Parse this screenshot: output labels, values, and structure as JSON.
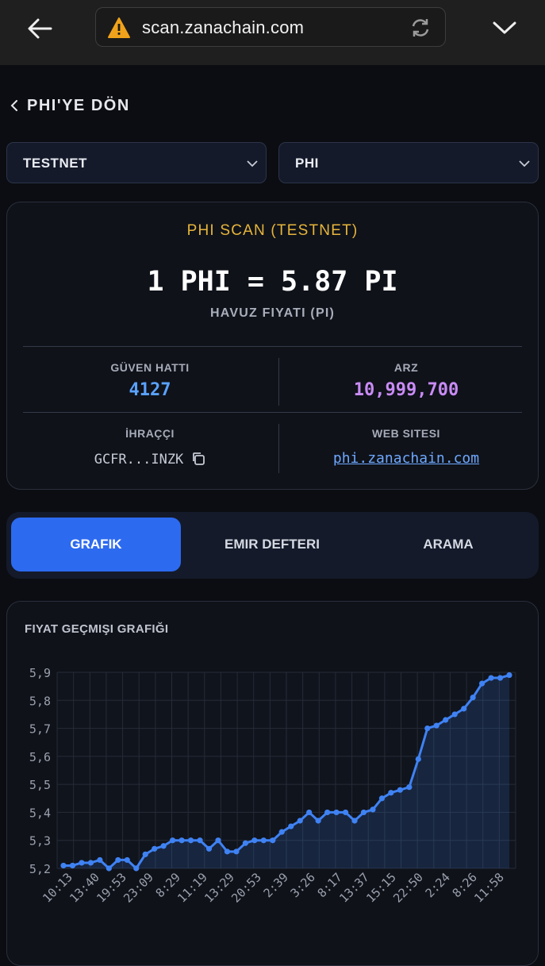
{
  "browser": {
    "url": "scan.zanachain.com",
    "icons": {
      "back": "arrow-left-icon",
      "warning": "warning-triangle-icon",
      "reload": "reload-icon",
      "menu": "chevron-down-icon"
    }
  },
  "nav": {
    "back_label": "PHI'YE DÖN"
  },
  "selectors": {
    "network": "TESTNET",
    "token": "PHI"
  },
  "card": {
    "title": "PHI SCAN (TESTNET)",
    "price": "1 PHI = 5.87 PI",
    "price_label": "HAVUZ FIYATI (PI)",
    "trustline_label": "GÜVEN HATTI",
    "trustline_value": "4127",
    "supply_label": "ARZ",
    "supply_value": "10,999,700",
    "issuer_label": "İHRAÇÇI",
    "issuer_value": "GCFR...INZK",
    "website_label": "WEB SITESI",
    "website_value": "phi.zanachain.com"
  },
  "colors": {
    "accent": "#2c6af0",
    "title_gold": "#e7b53b",
    "trustline": "#5aa2ff",
    "supply": "#c98bf5",
    "line": "#3f82f3"
  },
  "tabs": [
    {
      "label": "GRAFIK",
      "active": true
    },
    {
      "label": "EMIR DEFTERI",
      "active": false
    },
    {
      "label": "ARAMA",
      "active": false
    }
  ],
  "chart_title": "FIYAT GEÇMIŞI GRAFIĞI",
  "chart_data": {
    "type": "area",
    "title": "FIYAT GEÇMIŞI GRAFIĞI",
    "xlabel": "",
    "ylabel": "",
    "ylim": [
      5.2,
      5.9
    ],
    "yticks": [
      "5,2",
      "5,3",
      "5,4",
      "5,5",
      "5,6",
      "5,7",
      "5,8",
      "5,9"
    ],
    "xtick_labels": [
      "10:13",
      "13:40",
      "19:53",
      "23:09",
      "8:29",
      "11:19",
      "13:29",
      "20:53",
      "2:39",
      "3:26",
      "8:17",
      "13:37",
      "15:15",
      "22:50",
      "2:24",
      "8:26",
      "11:58"
    ],
    "grid": true,
    "values": [
      5.21,
      5.21,
      5.22,
      5.22,
      5.23,
      5.2,
      5.23,
      5.23,
      5.2,
      5.25,
      5.27,
      5.28,
      5.3,
      5.3,
      5.3,
      5.3,
      5.27,
      5.3,
      5.26,
      5.26,
      5.29,
      5.3,
      5.3,
      5.3,
      5.33,
      5.35,
      5.37,
      5.4,
      5.37,
      5.4,
      5.4,
      5.4,
      5.37,
      5.4,
      5.41,
      5.45,
      5.47,
      5.48,
      5.49,
      5.59,
      5.7,
      5.71,
      5.73,
      5.75,
      5.77,
      5.81,
      5.86,
      5.88,
      5.88,
      5.89
    ]
  }
}
